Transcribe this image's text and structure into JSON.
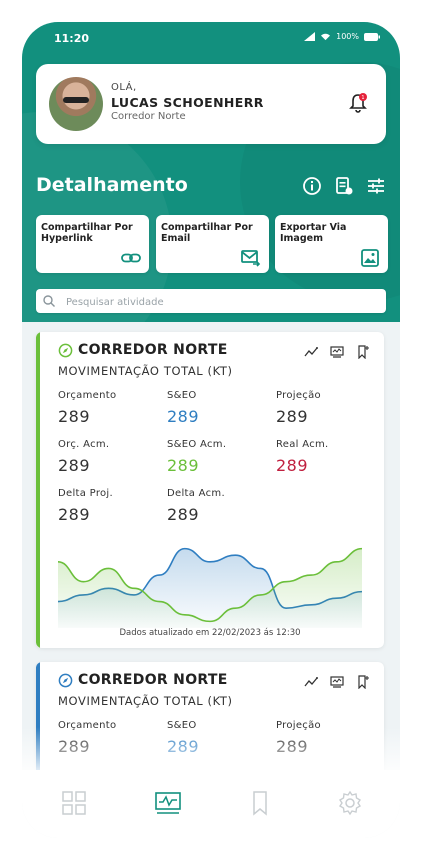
{
  "status": {
    "time": "11:20",
    "battery": "100%"
  },
  "profile": {
    "greeting": "OLÁ,",
    "name": "LUCAS SCHOENHERR",
    "role": "Corredor Norte",
    "notification_count": "1"
  },
  "section": {
    "title": "Detalhamento",
    "icons": [
      "info-icon",
      "report-icon",
      "filter-icon"
    ]
  },
  "share": [
    {
      "label": "Compartilhar Por Hyperlink",
      "icon": "link-icon"
    },
    {
      "label": "Compartilhar Por Email",
      "icon": "email-forward-icon"
    },
    {
      "label": "Exportar Via Imagem",
      "icon": "image-icon"
    }
  ],
  "search": {
    "placeholder": "Pesquisar atividade"
  },
  "colors": {
    "primary": "#12907e",
    "blue": "#2f7ec1",
    "green": "#6bbf3a",
    "red": "#c0203f"
  },
  "cards": [
    {
      "name": "CORREDOR NORTE",
      "subtitle": "MOVIMENTAÇÃO TOTAL (KT)",
      "metrics": [
        {
          "label": "Orçamento",
          "value": "289",
          "color": "#333333"
        },
        {
          "label": "S&EO",
          "value": "289",
          "color": "#2f7ec1"
        },
        {
          "label": "Projeção",
          "value": "289",
          "color": "#333333"
        },
        {
          "label": "Orç. Acm.",
          "value": "289",
          "color": "#333333"
        },
        {
          "label": "S&EO Acm.",
          "value": "289",
          "color": "#6bbf3a"
        },
        {
          "label": "Real Acm.",
          "value": "289",
          "color": "#c0203f"
        },
        {
          "label": "Delta Proj.",
          "value": "289",
          "color": "#333333"
        },
        {
          "label": "Delta Acm.",
          "value": "289",
          "color": "#333333"
        }
      ],
      "updated": "Dados atualizado em 22/02/2023 ás 12:30"
    },
    {
      "name": "CORREDOR NORTE",
      "subtitle": "MOVIMENTAÇÃO TOTAL (KT)",
      "metrics": [
        {
          "label": "Orçamento",
          "value": "289",
          "color": "#333333"
        },
        {
          "label": "S&EO",
          "value": "289",
          "color": "#2f7ec1"
        },
        {
          "label": "Projeção",
          "value": "289",
          "color": "#333333"
        }
      ]
    }
  ],
  "chart_data": {
    "type": "area",
    "x": [
      0,
      1,
      2,
      3,
      4,
      5,
      6,
      7,
      8,
      9,
      10,
      11,
      12
    ],
    "series": [
      {
        "color": "#2f7ec1",
        "values": [
          4,
          5,
          6,
          5,
          8,
          12,
          10,
          11,
          9,
          3,
          3.5,
          4.5,
          5.5
        ]
      },
      {
        "color": "#6bbf3a",
        "values": [
          10,
          7,
          9,
          6,
          4,
          2,
          1,
          3,
          5,
          7,
          8,
          10,
          12
        ]
      }
    ],
    "ylim": [
      0,
      13
    ]
  },
  "tabs": [
    {
      "icon": "grid-icon",
      "active": false
    },
    {
      "icon": "chart-icon",
      "active": true
    },
    {
      "icon": "bookmark-icon",
      "active": false
    },
    {
      "icon": "settings-icon",
      "active": false
    }
  ]
}
